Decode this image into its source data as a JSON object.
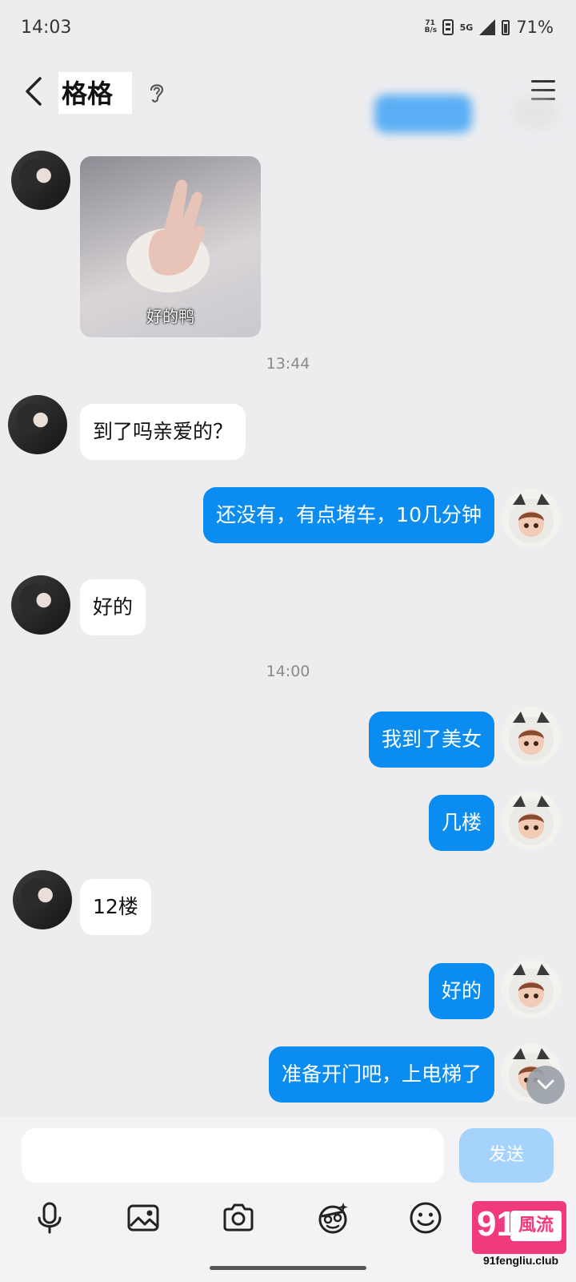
{
  "status_bar": {
    "time": "14:03",
    "net_speed": "71\nB/s",
    "network": "5G",
    "battery": "71%"
  },
  "header": {
    "title": "格格",
    "back_icon": "chevron-left-icon",
    "ear_icon": "ear-icon",
    "menu_icon": "menu-icon"
  },
  "messages": [
    {
      "type": "sticker",
      "side": "in",
      "caption": "好的鸭"
    },
    {
      "type": "time",
      "text": "13:44"
    },
    {
      "type": "text",
      "side": "in",
      "text": "到了吗亲爱的？"
    },
    {
      "type": "text",
      "side": "out",
      "text": "还没有，有点堵车，10几分钟"
    },
    {
      "type": "text",
      "side": "in",
      "text": "好的"
    },
    {
      "type": "time",
      "text": "14:00"
    },
    {
      "type": "text",
      "side": "out",
      "text": "我到了美女"
    },
    {
      "type": "text",
      "side": "out",
      "text": "几楼"
    },
    {
      "type": "text",
      "side": "in",
      "text": "12楼"
    },
    {
      "type": "text",
      "side": "out",
      "text": "好的"
    },
    {
      "type": "text",
      "side": "out",
      "text": "准备开门吧，上电梯了"
    }
  ],
  "input": {
    "value": "",
    "send_label": "发送"
  },
  "toolbar": [
    "microphone-icon",
    "image-icon",
    "camera-icon",
    "sticker-icon",
    "emoji-icon"
  ],
  "watermark": {
    "number": "91",
    "chinese": "風流",
    "url": "91fengliu.club"
  },
  "colors": {
    "outgoing_bubble": "#0a8cf0",
    "incoming_bubble": "#ffffff",
    "background": "#ededf0",
    "send_button": "#a5d3fb"
  }
}
